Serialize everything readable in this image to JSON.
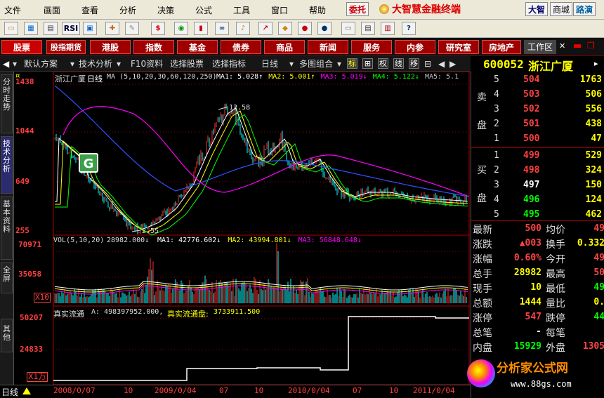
{
  "menu": [
    "文件",
    "画面",
    "查看",
    "分析",
    "决策",
    "公式",
    "工具",
    "窗口",
    "帮助"
  ],
  "top_buttons": {
    "weituo": "委托",
    "dazhi": "大智",
    "shangcheng": "商城",
    "lulu": "路演"
  },
  "app_title": "大智慧金融终端",
  "toolbar_icons": [
    "open-icon",
    "chart-icon",
    "table-icon",
    "rsi-label",
    "window-icon",
    "cross-icon",
    "ruler-icon",
    "dollar-icon",
    "stock-icon",
    "binoculars-icon",
    "bell-icon",
    "arrow-up-icon",
    "diamond-icon",
    "f10-icon",
    "trade-icon",
    "notepad-icon",
    "news-icon",
    "books-icon",
    "help-icon"
  ],
  "rsi_label": "RSI",
  "categories": [
    "股票",
    "股指期货",
    "港股",
    "指数",
    "基金",
    "债券",
    "商品",
    "新闻",
    "服务",
    "内参",
    "研究室",
    "房地产"
  ],
  "workarea": "工作区",
  "subbar": {
    "scheme": "默认方案",
    "tech": "技术分析",
    "f10": "F10资料",
    "select_stock": "选择股票",
    "select_index": "选择指标",
    "period": "日线",
    "multi": "多图组合",
    "btn_biao": "标",
    "btn_plus": "田",
    "btn_quan": "权",
    "btn_xian": "线",
    "btn_yi": "移"
  },
  "stock": {
    "code": "600052",
    "name": "浙江广厦"
  },
  "side_tabs": [
    "分时走势",
    "技术分析",
    "基本资料",
    "全屏",
    "其他"
  ],
  "price_chart": {
    "title": "浙江广厦",
    "period": "日线",
    "ma_label": "MA (5,10,20,30,60,120,250)",
    "ma_values": [
      {
        "label": "MA1: 5.028↑",
        "color": "#ffffff"
      },
      {
        "label": "MA2: 5.001↑",
        "color": "#ffff00"
      },
      {
        "label": "MA3: 5.019↓",
        "color": "#ff00ff"
      },
      {
        "label": "MA4: 5.122↓",
        "color": "#00ff00"
      },
      {
        "label": "MA5: 5.1",
        "color": "#c0c0c0"
      }
    ],
    "y_ticks": [
      "1438",
      "1044",
      "649",
      "255"
    ],
    "high_label": "12.58",
    "low_label": "2.55"
  },
  "volume_chart": {
    "label": "VOL(5,10,20)",
    "value": "28982.000↓",
    "ma": [
      {
        "label": "MA1: 42776.602↓",
        "color": "#ffffff"
      },
      {
        "label": "MA2: 43994.801↓",
        "color": "#ffff00"
      },
      {
        "label": "MA3: 56848.648↓",
        "color": "#ff00ff"
      }
    ],
    "y_ticks": [
      "70971",
      "35058"
    ],
    "unit": "X10"
  },
  "float_chart": {
    "label": "真实流通",
    "a_value": "A: 498397952.000,",
    "pan_label": "真实流通盘:",
    "pan_value": "3733911.500",
    "y_ticks": [
      "50207",
      "24833"
    ],
    "unit": "X1万"
  },
  "x_axis": {
    "period": "日线",
    "labels": [
      "2008/0/07",
      "10",
      "2009/0/04",
      "07",
      "10",
      "2010/0/04",
      "07",
      "10",
      "2011/0/04"
    ]
  },
  "order_book": {
    "sell_label": [
      "卖",
      "盘"
    ],
    "buy_label": [
      "买",
      "盘"
    ],
    "sell": [
      {
        "lvl": "5",
        "price": "504",
        "vol": "1763"
      },
      {
        "lvl": "4",
        "price": "503",
        "vol": "506"
      },
      {
        "lvl": "3",
        "price": "502",
        "vol": "556"
      },
      {
        "lvl": "2",
        "price": "501",
        "vol": "438"
      },
      {
        "lvl": "1",
        "price": "500",
        "vol": "47"
      }
    ],
    "buy": [
      {
        "lvl": "1",
        "price": "499",
        "vol": "529"
      },
      {
        "lvl": "2",
        "price": "498",
        "vol": "324"
      },
      {
        "lvl": "3",
        "price": "497",
        "vol": "150"
      },
      {
        "lvl": "4",
        "price": "496",
        "vol": "124"
      },
      {
        "lvl": "5",
        "price": "495",
        "vol": "462"
      }
    ]
  },
  "quote": [
    {
      "l": "最新",
      "v": "500",
      "vc": "#ff4444",
      "l2": "均价",
      "v2": "49",
      "vc2": "#ff4444"
    },
    {
      "l": "涨跌",
      "v": "▲003",
      "vc": "#ff4444",
      "l2": "换手",
      "v2": "0.332",
      "vc2": "#ffff00"
    },
    {
      "l": "涨幅",
      "v": "0.60%",
      "vc": "#ff4444",
      "l2": "今开",
      "v2": "49",
      "vc2": "#ff4444"
    },
    {
      "l": "总手",
      "v": "28982",
      "vc": "#ffff00",
      "l2": "最高",
      "v2": "50",
      "vc2": "#ff4444"
    },
    {
      "l": "现手",
      "v": "10",
      "vc": "#ffff00",
      "l2": "最低",
      "v2": "49",
      "vc2": "#00ff00"
    },
    {
      "l": "总额",
      "v": "1444",
      "vc": "#ffff00",
      "l2": "量比",
      "v2": "0.",
      "vc2": "#ffff00"
    },
    {
      "l": "涨停",
      "v": "547",
      "vc": "#ff4444",
      "l2": "跌停",
      "v2": "44",
      "vc2": "#00ff00"
    },
    {
      "l": "总笔",
      "v": "-",
      "vc": "#ffffff",
      "l2": "每笔",
      "v2": "",
      "vc2": "#ffffff"
    },
    {
      "l": "内盘",
      "v": "15929",
      "vc": "#00ff00",
      "l2": "外盘",
      "v2": "1305",
      "vc2": "#ff4444"
    }
  ],
  "watermark": {
    "brand": "分析家公式网",
    "url": "www.88gs.com"
  },
  "colors": {
    "up": "#ff3030",
    "down": "#00ffff",
    "ma_white": "#ffffff",
    "ma_yellow": "#ffff00",
    "ma_magenta": "#ff00ff",
    "ma_green": "#00ff00",
    "ma_blue": "#3050ff",
    "grid": "#8b0000"
  }
}
